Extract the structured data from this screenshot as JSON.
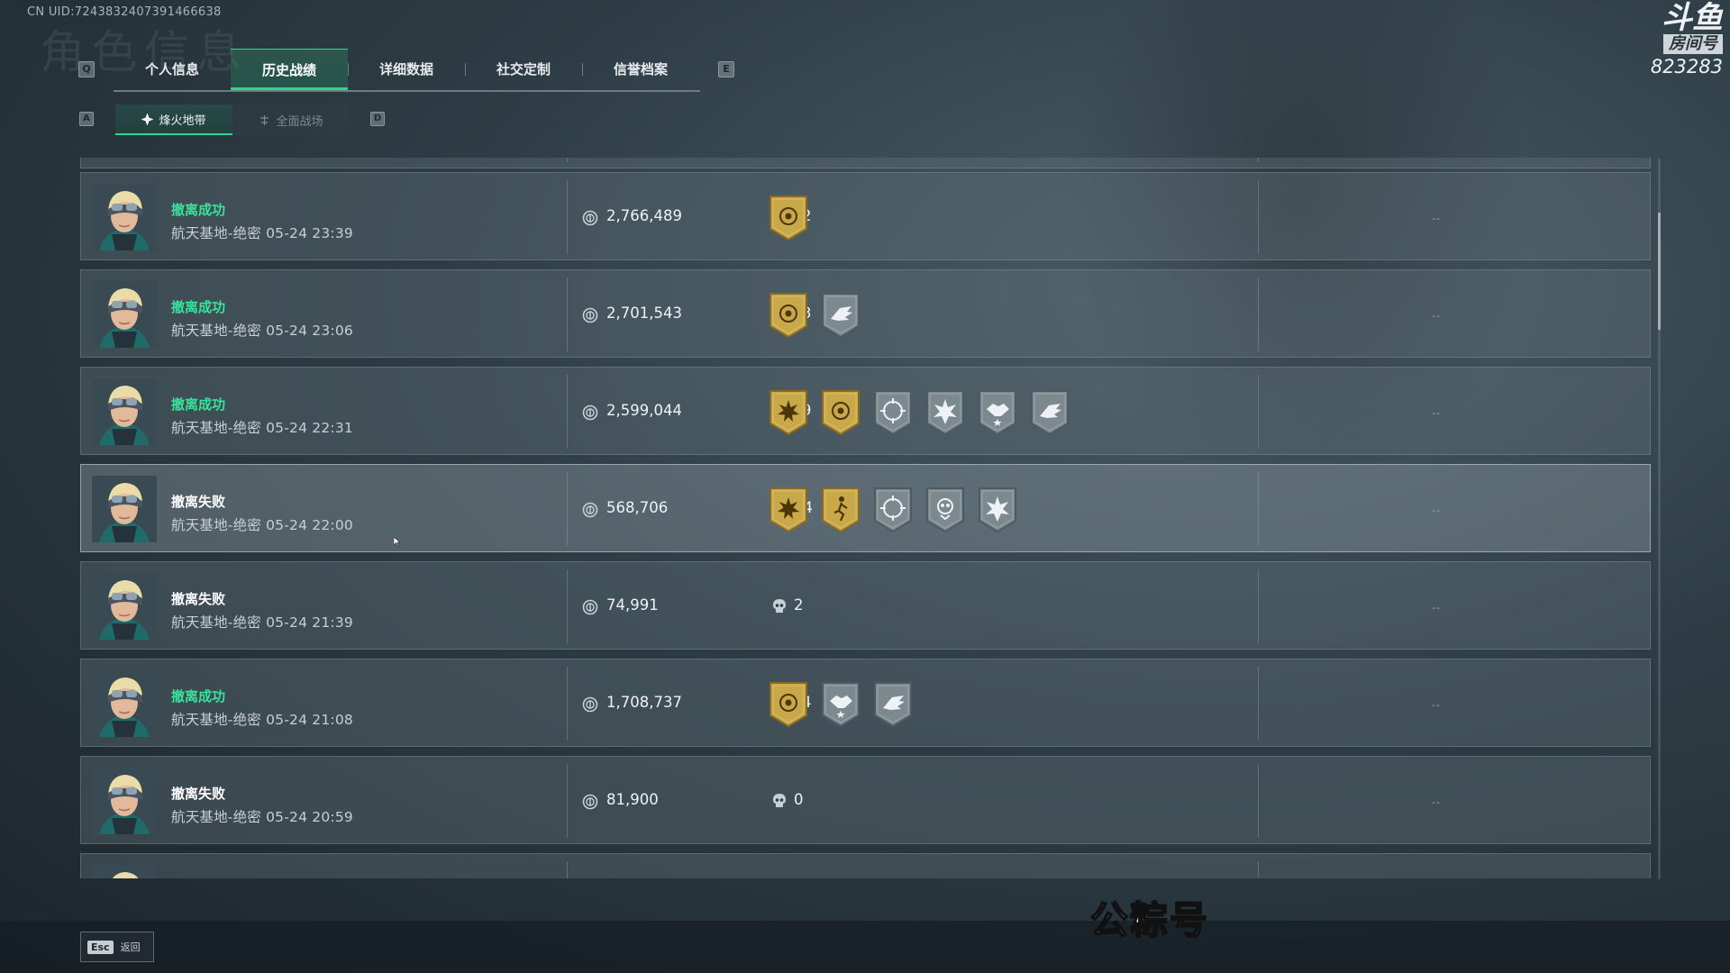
{
  "header": {
    "uid": "CN UID:7243832407391466638",
    "ghost_title": "角色信息",
    "brand_logo": "斗鱼",
    "brand_room_label": "房间号",
    "brand_room_number": "823283"
  },
  "keyhints": {
    "prev_tab": "Q",
    "next_tab": "E",
    "prev_sub": "A",
    "next_sub": "D"
  },
  "tabs": [
    {
      "label": "个人信息",
      "active": false
    },
    {
      "label": "历史战绩",
      "active": true
    },
    {
      "label": "详细数据",
      "active": false
    },
    {
      "label": "社交定制",
      "active": false
    },
    {
      "label": "信誉档案",
      "active": false
    }
  ],
  "subtabs": [
    {
      "label": "烽火地带",
      "active": true
    },
    {
      "label": "全面战场",
      "active": false
    }
  ],
  "matches": [
    {
      "status": "撤离成功",
      "success": true,
      "detail": "航天基地-绝密 05-24 23:39",
      "value": "2,766,489",
      "kills": "2",
      "badges": [
        "gold-coin"
      ],
      "dash": "--"
    },
    {
      "status": "撤离成功",
      "success": true,
      "detail": "航天基地-绝密 05-24 23:06",
      "value": "2,701,543",
      "kills": "3",
      "badges": [
        "gold-coin",
        "gray-wing"
      ],
      "dash": "--"
    },
    {
      "status": "撤离成功",
      "success": true,
      "detail": "航天基地-绝密 05-24 22:31",
      "value": "2,599,044",
      "kills": "9",
      "badges": [
        "gold-sun",
        "gold-coin",
        "gray-target",
        "gray-burst",
        "gray-hand",
        "gray-wing"
      ],
      "dash": "--"
    },
    {
      "status": "撤离失败",
      "success": false,
      "detail": "航天基地-绝密 05-24 22:00",
      "value": "568,706",
      "kills": "14",
      "badges": [
        "gold-sun",
        "gold-runner",
        "gray-target",
        "gray-skull",
        "gray-burst"
      ],
      "dash": "--"
    },
    {
      "status": "撤离失败",
      "success": false,
      "detail": "航天基地-绝密 05-24 21:39",
      "value": "74,991",
      "kills": "2",
      "badges": [],
      "dash": "--"
    },
    {
      "status": "撤离成功",
      "success": true,
      "detail": "航天基地-绝密 05-24 21:08",
      "value": "1,708,737",
      "kills": "4",
      "badges": [
        "gold-coin",
        "gray-hand",
        "gray-wing"
      ],
      "dash": "--"
    },
    {
      "status": "撤离失败",
      "success": false,
      "detail": "航天基地-绝密 05-24 20:59",
      "value": "81,900",
      "kills": "0",
      "badges": [],
      "dash": "--"
    }
  ],
  "footer": {
    "esc_key": "Esc",
    "back_label": "返回"
  },
  "overlay_watermark": "公粽号",
  "colors": {
    "accent": "#2fd48e",
    "success_text": "#37e39b",
    "gold_badge": "#c9a84a",
    "gray_badge": "#7c8a90"
  }
}
